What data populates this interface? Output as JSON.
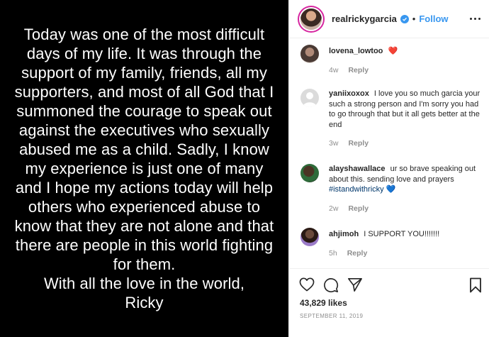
{
  "post": {
    "text": "Today was one of the most difficult\ndays of my life. It was through the\nsupport of my family, friends, all my\nsupporters, and most of all God that I\nsummoned the courage to speak out\nagainst the executives who sexually\nabused me as a child. Sadly, I know\nmy experience is just one of many\nand I hope my actions today will help\nothers who experienced abuse to\nknow that they are not alone and that\nthere are people in this world fighting\nfor them.\nWith all the love in the world,\nRicky"
  },
  "header": {
    "username": "realrickygarcia",
    "dot": "•",
    "follow_label": "Follow",
    "verified_icon": "verified-badge-icon",
    "more_icon": "more-options-icon"
  },
  "comments": [
    {
      "username": "lovena_lowtoo",
      "text": "",
      "emoji": "❤️",
      "hashtag": "",
      "age": "4w",
      "reply_label": "Reply"
    },
    {
      "username": "yaniixoxox",
      "text": "I love you so much garcia your such a strong person and I'm sorry you had to go through that but it all gets better at the end",
      "emoji": "",
      "hashtag": "",
      "age": "3w",
      "reply_label": "Reply"
    },
    {
      "username": "alayshawallace",
      "text": "ur so brave speaking out about this. sending love and prayers ",
      "emoji": "💙",
      "hashtag": "#istandwithricky",
      "age": "2w",
      "reply_label": "Reply"
    },
    {
      "username": "ahjimoh",
      "text": "I SUPPORT YOU!!!!!!!",
      "emoji": "",
      "hashtag": "",
      "age": "5h",
      "reply_label": "Reply"
    }
  ],
  "actions": {
    "likes_count": "43,829",
    "likes_label": "likes",
    "date": "SEPTEMBER 11, 2019",
    "icons": [
      "heart-icon",
      "comment-icon",
      "share-icon",
      "bookmark-icon"
    ]
  },
  "colors": {
    "accent": "#3897f0",
    "text": "#262626",
    "muted": "#8e8e8e",
    "hashtag": "#00376b",
    "heart": "#ed4956"
  }
}
